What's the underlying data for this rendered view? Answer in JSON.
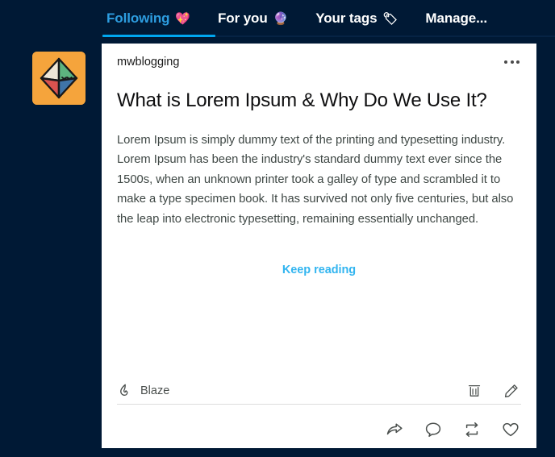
{
  "theme": {
    "background": "#001935",
    "card_background": "#ffffff",
    "accent": "#00a7f0",
    "active_tab_color": "#2d9de0",
    "link_color": "#32b5f0",
    "body_text_color": "#3f4845",
    "title_text_color": "#0f0f10",
    "divider_color": "#dcdcdc",
    "avatar_background": "#f5a43c"
  },
  "tabs": [
    {
      "label": "Following",
      "emoji": "💖",
      "emoji_name": "sparkling-heart-emoji",
      "active": true
    },
    {
      "label": "For you",
      "emoji": "🔮",
      "emoji_name": "crystal-ball-emoji",
      "active": false
    },
    {
      "label": "Your tags",
      "emoji": "🏷",
      "emoji_name": "label-tag-emoji",
      "active": false
    },
    {
      "label": "Manage...",
      "emoji": "",
      "emoji_name": "",
      "active": false
    }
  ],
  "avatar": {
    "name": "blog-avatar",
    "shape": "octahedron"
  },
  "post": {
    "blog_name": "mwblogging",
    "overflow_menu_label": "•••",
    "title": "What is Lorem Ipsum & Why Do We Use It?",
    "body": "Lorem Ipsum is simply dummy text of the printing and typesetting industry. Lorem Ipsum has been the industry's standard dummy text ever since the 1500s, when an unknown printer took a galley of type and scrambled it to make a type specimen book. It has survived not only five centuries, but also the leap into electronic typesetting, remaining essentially unchanged.",
    "keep_reading_label": "Keep reading",
    "blaze_label": "Blaze",
    "owner_actions": [
      {
        "name": "delete-post-button",
        "icon": "trash-icon"
      },
      {
        "name": "edit-post-button",
        "icon": "pencil-icon"
      }
    ],
    "engagement_actions": [
      {
        "name": "share-button",
        "icon": "share-arrow-icon"
      },
      {
        "name": "reply-button",
        "icon": "speech-bubble-icon"
      },
      {
        "name": "reblog-button",
        "icon": "reblog-arrows-icon"
      },
      {
        "name": "like-button",
        "icon": "heart-icon"
      }
    ]
  }
}
